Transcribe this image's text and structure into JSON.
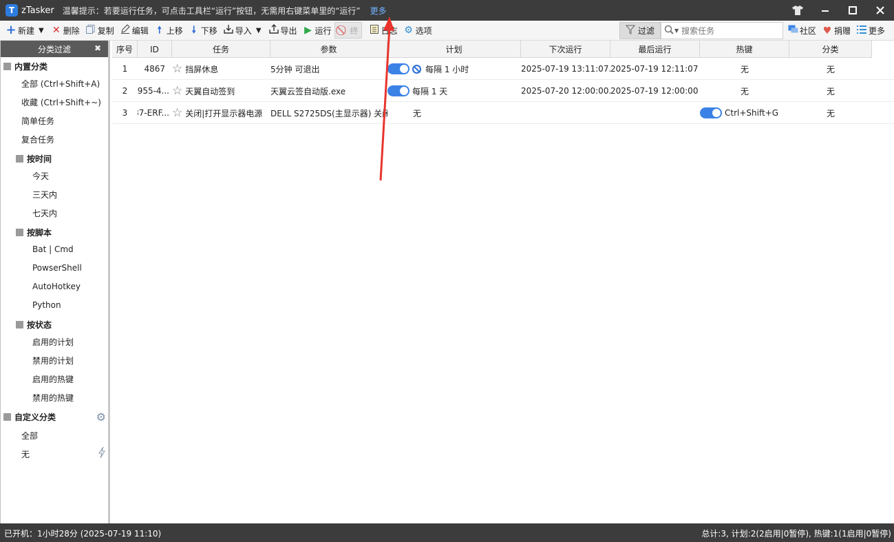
{
  "titlebar": {
    "logo_letter": "T",
    "app_name": "zTasker",
    "tip": "温馨提示：若要运行任务，可点击工具栏“运行”按钮，无需用右键菜单里的“运行”",
    "more_link": "更多",
    "icons": [
      "tshirt-icon",
      "minimize-icon",
      "maximize-icon",
      "close-icon"
    ]
  },
  "toolbar": {
    "new": "新建",
    "delete": "删除",
    "copy": "复制",
    "edit": "编辑",
    "move_up": "上移",
    "move_down": "下移",
    "import": "导入",
    "export": "导出",
    "run": "运行",
    "stop": "终",
    "log": "日志",
    "options": "选项",
    "filter": "过滤",
    "search_placeholder": "搜索任务",
    "community": "社区",
    "donate": "捐赠",
    "more": "更多"
  },
  "sidebar": {
    "header": "分类过滤",
    "builtin_group": "内置分类",
    "all": "全部 (Ctrl+Shift+A)",
    "favorites": "收藏 (Ctrl+Shift+~)",
    "simple_tasks": "简单任务",
    "composite_tasks": "复合任务",
    "by_time": "按时间",
    "today": "今天",
    "three_days": "三天内",
    "seven_days": "七天内",
    "by_script": "按脚本",
    "bat_cmd": "Bat | Cmd",
    "powershell": "PowserShell",
    "autohotkey": "AutoHotkey",
    "python": "Python",
    "by_status": "按状态",
    "enabled_plans": "启用的计划",
    "disabled_plans": "禁用的计划",
    "enabled_hotkeys": "启用的热键",
    "disabled_hotkeys": "禁用的热键",
    "custom_group": "自定义分类",
    "custom_all": "全部",
    "custom_none": "无"
  },
  "grid": {
    "columns": [
      "序号",
      "ID",
      "任务",
      "参数",
      "计划",
      "下次运行",
      "最后运行",
      "热键",
      "分类"
    ],
    "rows": [
      {
        "no": "1",
        "id": "4867",
        "task": "挡屏休息",
        "params": "5分钟 可退出",
        "plan_enabled": true,
        "plan_disabled_mark": true,
        "plan": "每隔 1 小时",
        "next_run": "2025-07-19 13:11:07...",
        "last_run": "2025-07-19 12:11:07",
        "hotkey_enabled": false,
        "hotkey": "无",
        "category": "无"
      },
      {
        "no": "2",
        "id": "955-4...",
        "task": "天翼自动签到",
        "params": "天翼云签自动版.exe",
        "plan_enabled": true,
        "plan_disabled_mark": false,
        "plan": "每隔 1 天",
        "next_run": "2025-07-20 12:00:00...",
        "last_run": "2025-07-19 12:00:00",
        "hotkey_enabled": false,
        "hotkey": "无",
        "category": "无"
      },
      {
        "no": "3",
        "id": "87-ERF...",
        "task": "关闭|打开显示器电源",
        "params": "DELL S2725DS(主显示器) 关闭",
        "plan_enabled": false,
        "plan_disabled_mark": false,
        "plan": "无",
        "next_run": "",
        "last_run": "",
        "hotkey_enabled": true,
        "hotkey": "Ctrl+Shift+G",
        "category": "无"
      }
    ]
  },
  "statusbar": {
    "left": "已开机：1小时28分 (2025-07-19 11:10)",
    "right": "总计:3, 计划:2(2启用|0暂停), 热键:1(1启用|0暂停)"
  },
  "colors": {
    "titlebar_bg": "#3c3c3c",
    "accent_blue": "#3b82e6",
    "link_blue": "#6fb3ff",
    "annotation_red": "#e8342c"
  }
}
